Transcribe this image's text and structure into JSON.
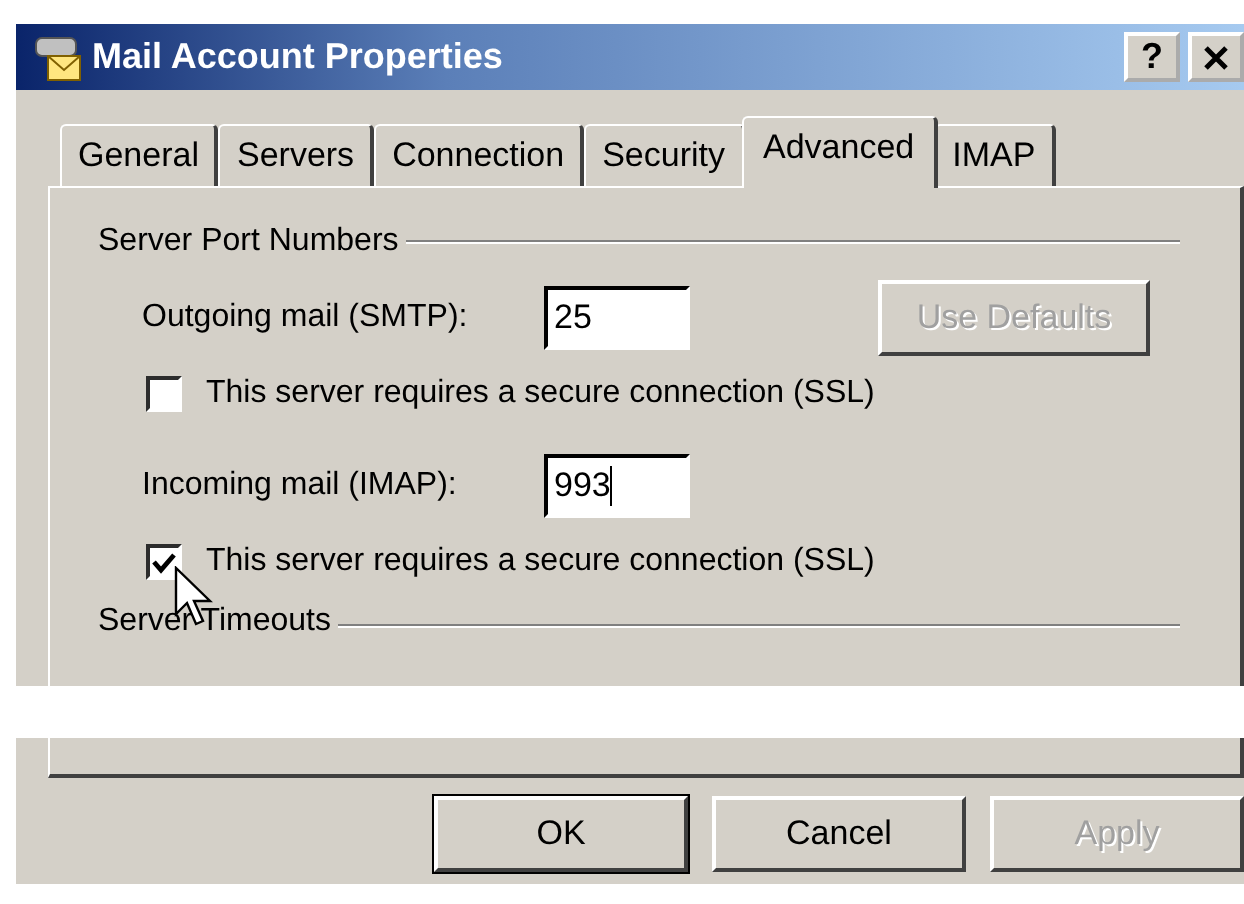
{
  "window": {
    "title": "Mail Account Properties",
    "help": "?"
  },
  "tabs": [
    {
      "label": "General",
      "selected": false
    },
    {
      "label": "Servers",
      "selected": false
    },
    {
      "label": "Connection",
      "selected": false
    },
    {
      "label": "Security",
      "selected": false
    },
    {
      "label": "Advanced",
      "selected": true
    },
    {
      "label": "IMAP",
      "selected": false
    }
  ],
  "port_group": {
    "title": "Server Port Numbers",
    "rows": [
      {
        "kind": "port",
        "label": "Outgoing mail (SMTP):",
        "value": "25",
        "focused": false,
        "button": {
          "label": "Use Defaults",
          "disabled": true
        }
      },
      {
        "kind": "checkbox",
        "label": "This server requires a secure connection (SSL)",
        "checked": false
      },
      {
        "kind": "port",
        "label": "Incoming mail (IMAP):",
        "value": "993",
        "focused": true
      },
      {
        "kind": "checkbox",
        "label": "This server requires a secure connection (SSL)",
        "checked": true
      }
    ]
  },
  "timeout_group": {
    "title": "Server Timeouts"
  },
  "buttons": [
    {
      "label": "OK",
      "default": true,
      "disabled": false
    },
    {
      "label": "Cancel",
      "default": false,
      "disabled": false
    },
    {
      "label": "Apply",
      "default": false,
      "disabled": true
    }
  ]
}
